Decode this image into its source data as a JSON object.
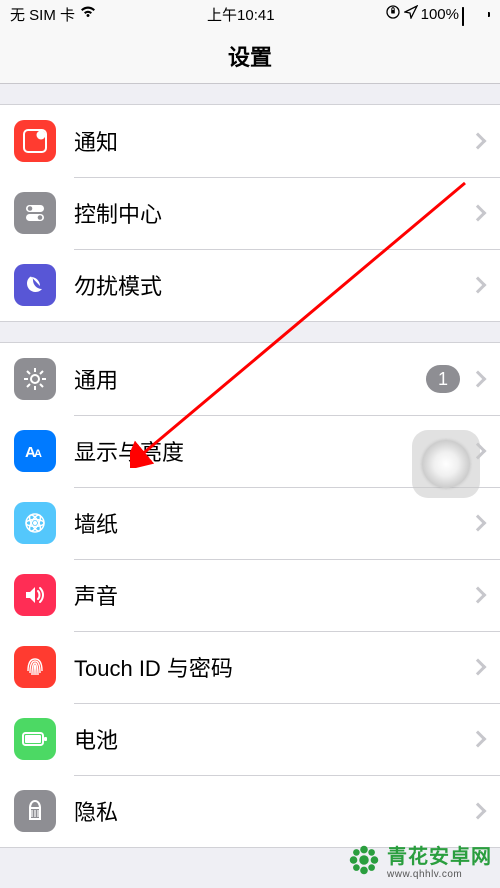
{
  "status": {
    "carrier": "无 SIM 卡",
    "time": "上午10:41",
    "battery": "100%"
  },
  "nav": {
    "title": "设置"
  },
  "sections": [
    {
      "items": [
        {
          "name": "notifications",
          "label": "通知",
          "iconName": "notifications-icon"
        },
        {
          "name": "control-center",
          "label": "控制中心",
          "iconName": "control-center-icon"
        },
        {
          "name": "dnd",
          "label": "勿扰模式",
          "iconName": "dnd-icon"
        }
      ]
    },
    {
      "items": [
        {
          "name": "general",
          "label": "通用",
          "iconName": "general-icon",
          "badge": "1"
        },
        {
          "name": "display",
          "label": "显示与亮度",
          "iconName": "display-icon"
        },
        {
          "name": "wallpaper",
          "label": "墙纸",
          "iconName": "wallpaper-icon"
        },
        {
          "name": "sound",
          "label": "声音",
          "iconName": "sound-icon"
        },
        {
          "name": "touchid",
          "label": "Touch ID 与密码",
          "iconName": "touchid-icon"
        },
        {
          "name": "battery",
          "label": "电池",
          "iconName": "battery-icon"
        },
        {
          "name": "privacy",
          "label": "隐私",
          "iconName": "privacy-icon"
        }
      ]
    }
  ],
  "watermark": {
    "brand": "青花安卓网",
    "url": "www.qhhlv.com"
  }
}
